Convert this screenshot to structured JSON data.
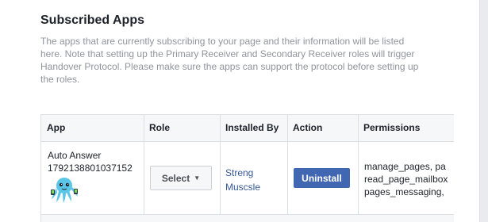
{
  "section": {
    "title": "Subscribed Apps",
    "description": "The apps that are currently subscribing to your page and their information will be listed here. Note that setting up the Primary Receiver and Secondary Receiver roles will trigger Handover Protocol. Please make sure the apps can support the protocol before setting up the roles."
  },
  "table": {
    "headers": {
      "app": "App",
      "role": "Role",
      "installed_by": "Installed By",
      "action": "Action",
      "permissions": "Permissions"
    },
    "rows": [
      {
        "app_name": "Auto Answer",
        "app_id": "1792138801037152",
        "app_icon": "octopus-icon",
        "role_select": "Select",
        "installed_by_line1": "Streng",
        "installed_by_line2": "Muscsle",
        "action_label": "Uninstall",
        "permissions_line1": "manage_pages, pa",
        "permissions_line2": "read_page_mailbox",
        "permissions_line3": "pages_messaging,"
      }
    ]
  },
  "colors": {
    "link": "#365899",
    "primary_button": "#4267b2",
    "muted_text": "#90949c"
  }
}
